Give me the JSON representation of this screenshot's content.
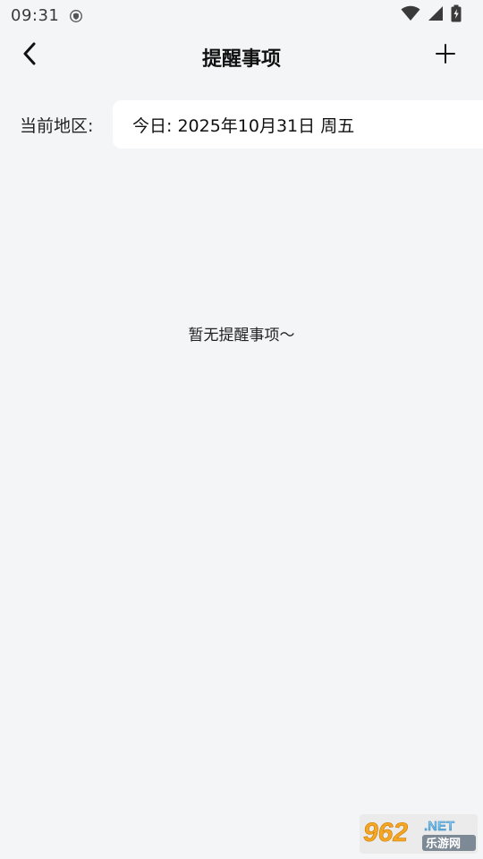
{
  "status_bar": {
    "time": "09:31",
    "icons": [
      "shield-icon",
      "wifi-icon",
      "cell-signal-icon",
      "battery-icon"
    ]
  },
  "header": {
    "title": "提醒事项",
    "back_icon": "chevron-left-icon",
    "add_icon": "plus-icon"
  },
  "region": {
    "label": "当前地区:",
    "date_text": "今日: 2025年10月31日 周五"
  },
  "empty_state": {
    "message": "暂无提醒事项～"
  },
  "watermark": {
    "text_top": "962.NET",
    "text_bottom": "乐游网"
  },
  "colors": {
    "background": "#f4f5f7",
    "card": "#ffffff",
    "text": "#111111",
    "watermark_orange": "#f5a623"
  }
}
